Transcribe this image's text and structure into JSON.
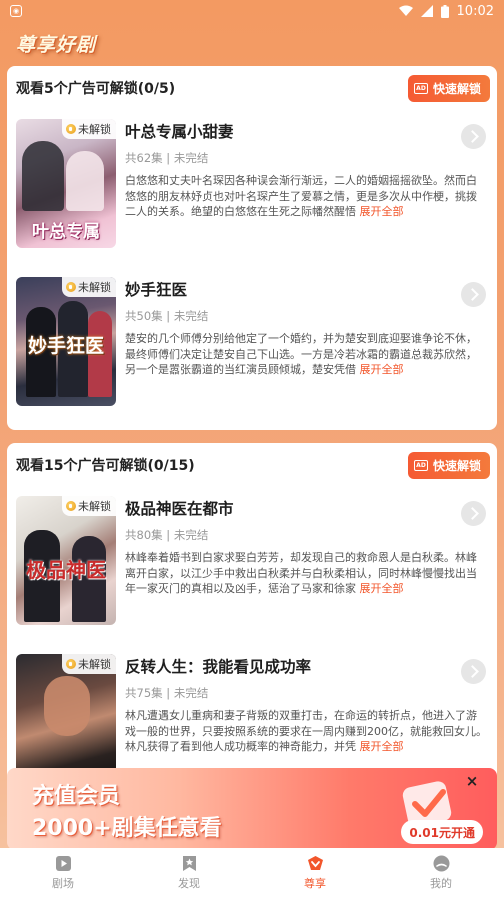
{
  "status_bar": {
    "time": "10:02"
  },
  "app": {
    "logo_text": "尊享好剧"
  },
  "sections": [
    {
      "title": "观看5个广告可解锁(0/5)",
      "quick_unlock": {
        "badge": "AD",
        "label": "快速解锁"
      },
      "items": [
        {
          "lock_label": "未解锁",
          "poster_text": "叶总专属",
          "title": "叶总专属小甜妻",
          "meta": "共62集 | 未完结",
          "desc": "白悠悠和丈夫叶名琛因各种误会渐行渐远，二人的婚姻摇摇欲坠。然而白悠悠的朋友林妤贞也对叶名琛产生了爱慕之情，更是多次从中作梗，挑拨二人的关系。绝望的白悠悠在生死之际幡然醒悟",
          "expand": "展开全部"
        },
        {
          "lock_label": "未解锁",
          "poster_text": "妙手狂医",
          "title": "妙手狂医",
          "meta": "共50集 | 未完结",
          "desc": "楚安的几个师傅分别给他定了一个婚约，并为楚安到底迎娶谁争论不休，最终师傅们决定让楚安自己下山选。一方是冷若冰霜的霸道总裁苏欣然，另一个是嚣张霸道的当红演员顾倾城，楚安凭借",
          "expand": "展开全部"
        }
      ]
    },
    {
      "title": "观看15个广告可解锁(0/15)",
      "quick_unlock": {
        "badge": "AD",
        "label": "快速解锁"
      },
      "items": [
        {
          "lock_label": "未解锁",
          "poster_text": "极品神医",
          "title": "极品神医在都市",
          "meta": "共80集 | 未完结",
          "desc": "林峰奉着婚书到白家求娶白芳芳，却发现自己的救命恩人是白秋柔。林峰离开白家，以江少手中救出白秋柔并与白秋柔相认，同时林峰慢慢找出当年一家灭门的真相以及凶手，惩治了马家和徐家",
          "expand": "展开全部"
        },
        {
          "lock_label": "未解锁",
          "poster_text": "",
          "title": "反转人生：我能看见成功率",
          "meta": "共75集 | 未完结",
          "desc": "林凡遭遇女儿重病和妻子背叛的双重打击，在命运的转折点，他进入了游戏一般的世界，只要按照系统的要求在一周内赚到200亿，就能救回女儿。林凡获得了看到他人成功概率的神奇能力，并凭",
          "expand": "展开全部"
        }
      ]
    }
  ],
  "banner": {
    "line1": "充值会员",
    "line2": "2000+剧集任意看",
    "price_label": "0.01元开通",
    "close": "×"
  },
  "tabbar": [
    {
      "label": "剧场",
      "icon": "play-icon",
      "active": false
    },
    {
      "label": "发现",
      "icon": "bookmark-star-icon",
      "active": false
    },
    {
      "label": "尊享",
      "icon": "crown-icon",
      "active": true
    },
    {
      "label": "我的",
      "icon": "profile-icon",
      "active": false
    }
  ]
}
